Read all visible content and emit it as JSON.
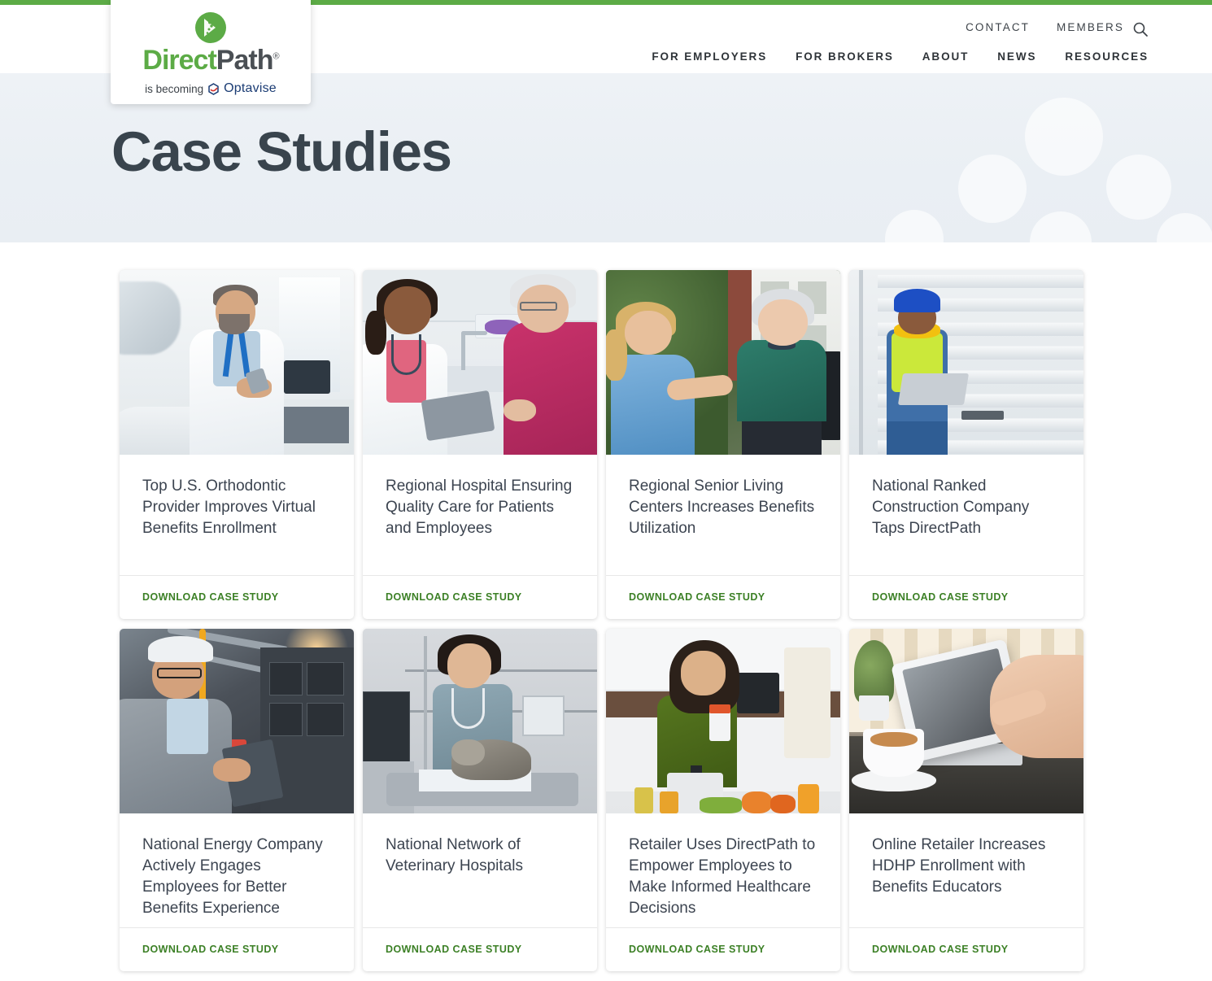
{
  "brand": {
    "logo_word_1": "Direct",
    "logo_word_2": "Path",
    "logo_registered": "®",
    "tagline_prefix": "is becoming",
    "tagline_brand": "Optavise",
    "green": "#5cab46",
    "navy": "#1b3c74"
  },
  "header": {
    "utility_nav": [
      {
        "label": "CONTACT"
      },
      {
        "label": "MEMBERS"
      }
    ],
    "search_icon": "search-icon",
    "main_nav": [
      {
        "label": "FOR EMPLOYERS"
      },
      {
        "label": "FOR BROKERS"
      },
      {
        "label": "ABOUT"
      },
      {
        "label": "NEWS"
      },
      {
        "label": "RESOURCES"
      }
    ]
  },
  "hero": {
    "title": "Case Studies"
  },
  "cards": [
    {
      "title": "Top U.S. Orthodontic Provider Improves Virtual Benefits Enrollment",
      "link_label": "DOWNLOAD CASE STUDY",
      "image_alt": "orthodontist-with-smartphone-photo"
    },
    {
      "title": "Regional Hospital Ensuring Quality Care for Patients and Employees",
      "link_label": "DOWNLOAD CASE STUDY",
      "image_alt": "doctor-with-tablet-and-senior-patient-photo"
    },
    {
      "title": "Regional Senior Living Centers Increases Benefits Utilization",
      "link_label": "DOWNLOAD CASE STUDY",
      "image_alt": "caregiver-with-senior-in-wheelchair-photo"
    },
    {
      "title": "National Ranked Construction Company Taps DirectPath",
      "link_label": "DOWNLOAD CASE STUDY",
      "image_alt": "construction-worker-with-laptop-photo"
    },
    {
      "title": "National Energy Company Actively Engages Employees for Better Benefits Experience",
      "link_label": "DOWNLOAD CASE STUDY",
      "image_alt": "engineer-with-tablet-in-plant-photo"
    },
    {
      "title": "National Network of Veterinary Hospitals",
      "link_label": "DOWNLOAD CASE STUDY",
      "image_alt": "veterinarian-examining-cat-photo"
    },
    {
      "title": "Retailer Uses DirectPath to Empower Employees to Make Informed Healthcare Decisions",
      "link_label": "DOWNLOAD CASE STUDY",
      "image_alt": "woman-in-kitchen-with-supplement-bottle-photo"
    },
    {
      "title": "Online Retailer Increases HDHP Enrollment with Benefits Educators",
      "link_label": "DOWNLOAD CASE STUDY",
      "image_alt": "hands-using-tablet-with-coffee-photo"
    }
  ]
}
